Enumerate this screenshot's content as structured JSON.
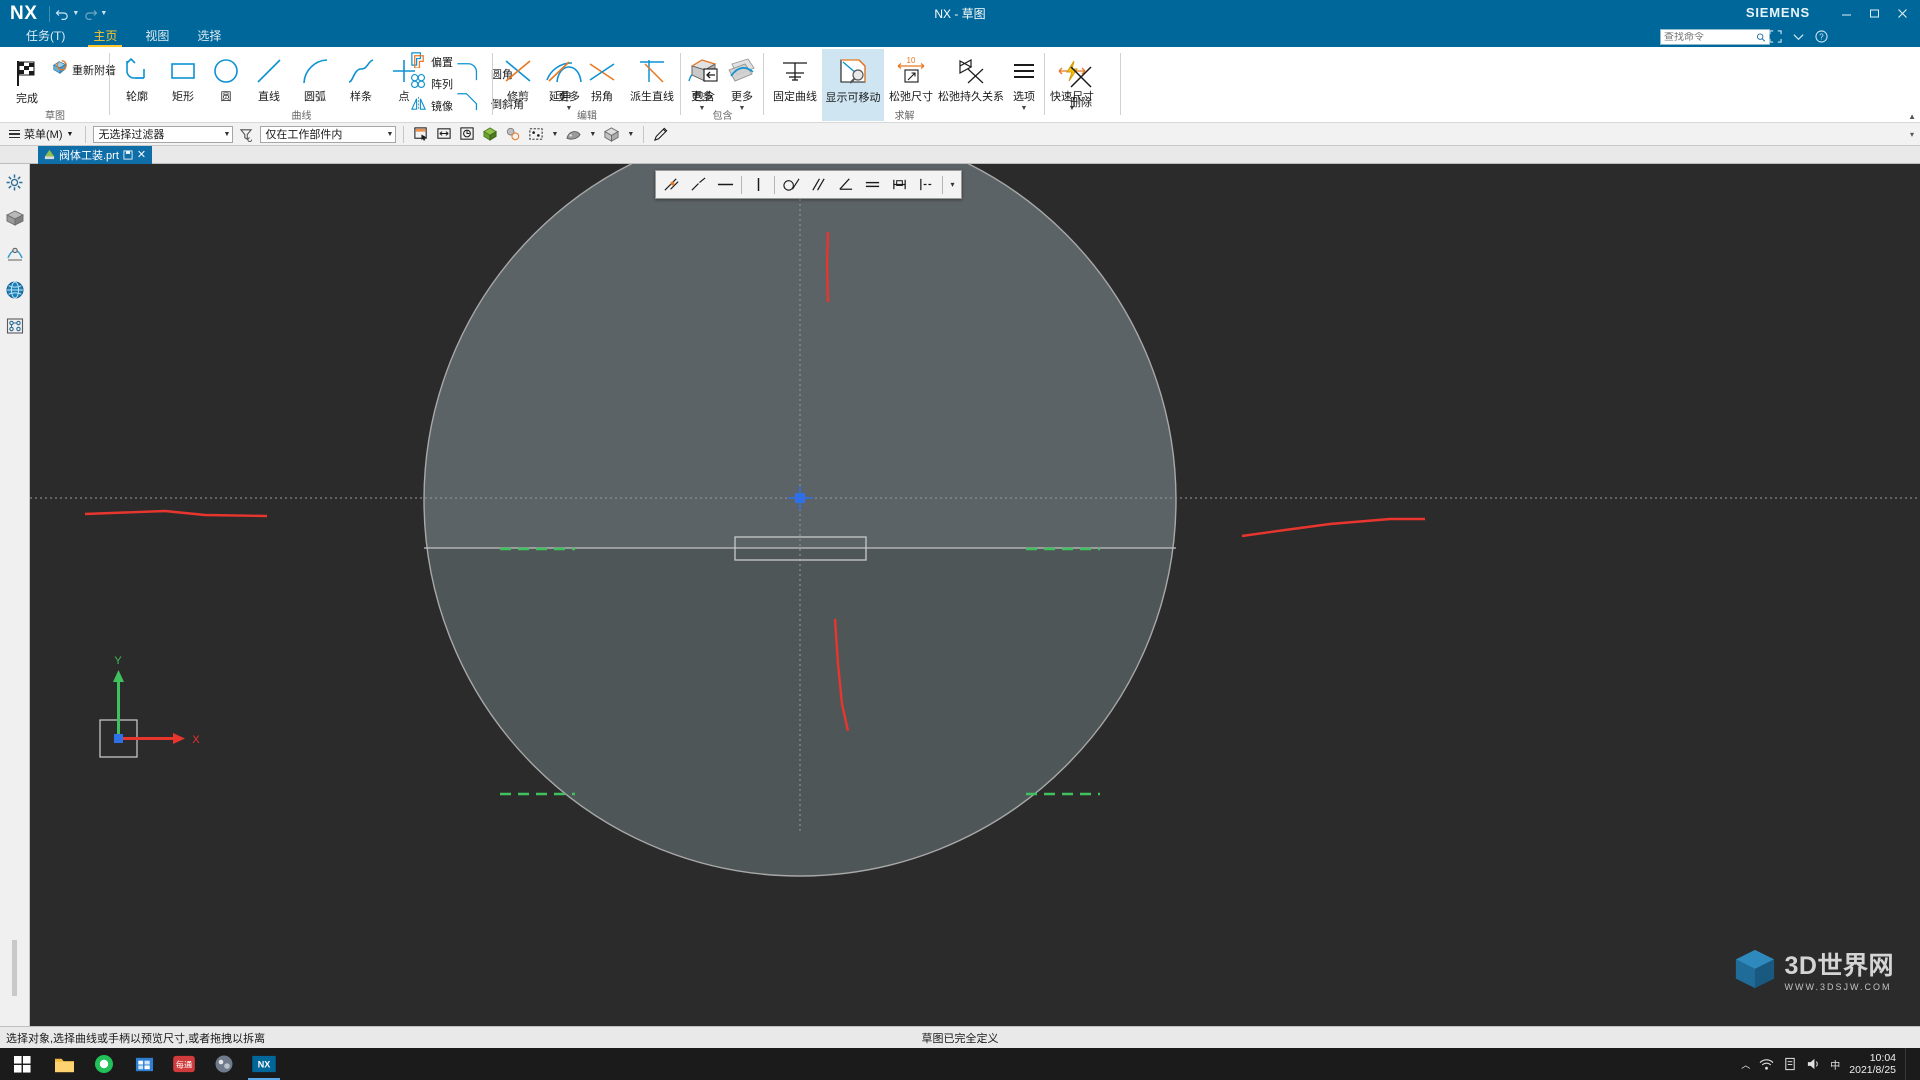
{
  "window": {
    "title": "NX - 草图",
    "brand": "SIEMENS",
    "logo": "NX",
    "quick_access": [
      "undo-icon",
      "redo-icon"
    ],
    "controls": [
      "minimize",
      "maximize",
      "close"
    ]
  },
  "tabs": [
    {
      "label": "任务(T)",
      "active": false
    },
    {
      "label": "主页",
      "active": true
    },
    {
      "label": "视图",
      "active": false
    },
    {
      "label": "选择",
      "active": false
    }
  ],
  "search": {
    "placeholder": "查找命令",
    "value": ""
  },
  "ribbon": {
    "groups": [
      {
        "name": "草图",
        "label": "草图",
        "buttons": [
          {
            "label": "完成",
            "icon": "finish-flag-icon",
            "type": "big"
          },
          {
            "label": "重新附着",
            "icon": "reattach-icon",
            "type": "small"
          }
        ]
      },
      {
        "name": "曲线",
        "label": "曲线",
        "buttons": [
          {
            "label": "轮廓",
            "icon": "profile-icon",
            "type": "big"
          },
          {
            "label": "矩形",
            "icon": "rectangle-icon",
            "type": "big"
          },
          {
            "label": "圆",
            "icon": "circle-icon",
            "type": "big"
          },
          {
            "label": "直线",
            "icon": "line-icon",
            "type": "big"
          },
          {
            "label": "圆弧",
            "icon": "arc-icon",
            "type": "big"
          },
          {
            "label": "样条",
            "icon": "spline-icon",
            "type": "big"
          },
          {
            "label": "点",
            "icon": "point-icon",
            "type": "big"
          },
          {
            "label": "圆角",
            "icon": "fillet-icon",
            "type": "small"
          },
          {
            "label": "倒斜角",
            "icon": "chamfer-icon",
            "type": "small"
          },
          {
            "label": "偏置",
            "icon": "offset-icon",
            "type": "small"
          },
          {
            "label": "阵列",
            "icon": "pattern-icon",
            "type": "small"
          },
          {
            "label": "镜像",
            "icon": "mirror-icon",
            "type": "small"
          },
          {
            "label": "更多",
            "icon": "more-curve-icon",
            "type": "big",
            "dropdown": true
          }
        ]
      },
      {
        "name": "编辑",
        "label": "编辑",
        "buttons": [
          {
            "label": "修剪",
            "icon": "trim-icon",
            "type": "big"
          },
          {
            "label": "延伸",
            "icon": "extend-icon",
            "type": "big"
          },
          {
            "label": "拐角",
            "icon": "corner-icon",
            "type": "big"
          },
          {
            "label": "派生直线",
            "icon": "derived-line-icon",
            "type": "big"
          },
          {
            "label": "更多",
            "icon": "more-edit-icon",
            "type": "big",
            "dropdown": true
          }
        ]
      },
      {
        "name": "包含",
        "label": "包含",
        "buttons": [
          {
            "label": "包含",
            "icon": "include-icon",
            "type": "big"
          },
          {
            "label": "更多",
            "icon": "more-include-icon",
            "type": "big",
            "dropdown": true
          }
        ]
      },
      {
        "name": "求解",
        "label": "求解",
        "buttons": [
          {
            "label": "固定曲线",
            "icon": "fix-curve-icon",
            "type": "big"
          },
          {
            "label": "显示可移动",
            "icon": "show-movable-icon",
            "type": "big",
            "selected": true
          },
          {
            "label": "松弛尺寸",
            "icon": "relax-dimension-icon",
            "type": "big"
          },
          {
            "label": "松弛持久关系",
            "icon": "relax-persistent-icon",
            "type": "big"
          },
          {
            "label": "选项",
            "icon": "options-icon",
            "type": "big",
            "dropdown": true
          },
          {
            "label": "快速尺寸",
            "icon": "quick-dimension-icon",
            "type": "big",
            "dropdown": true
          }
        ]
      },
      {
        "name": "删除",
        "label": "",
        "buttons": [
          {
            "label": "删除",
            "icon": "delete-x-icon",
            "type": "big"
          }
        ]
      }
    ]
  },
  "selection_bar": {
    "menu_label": "菜单(M)",
    "filter": {
      "value": "无选择过滤器",
      "placeholder": "无选择过滤器"
    },
    "scope": {
      "value": "仅在工作部件内",
      "placeholder": "仅在工作部件内"
    },
    "icons": [
      "select-face-icon",
      "select-edge-icon",
      "select-feature-icon",
      "shaded-icon",
      "wireframe-icon",
      "selection-window-icon",
      "render-style-icon"
    ]
  },
  "document_tab": {
    "name": "阀体工装.prt",
    "modified_icon": "save-state-icon",
    "close_icon": "close-icon"
  },
  "resource_bar": {
    "items": [
      "assembly-navigator-icon",
      "part-navigator-icon",
      "constraint-navigator-icon",
      "web-browser-icon",
      "history-icon"
    ]
  },
  "canvas_toolbar": {
    "buttons": [
      "coincident-constraint-icon",
      "collinear-constraint-icon",
      "horizontal-constraint-icon",
      "vertical-constraint-icon",
      "tangent-constraint-icon",
      "parallel-constraint-icon",
      "perpendicular-constraint-icon",
      "equal-length-constraint-icon",
      "midpoint-constraint-icon",
      "dimension-icon"
    ],
    "overflow": "more-constraints-caret"
  },
  "triad": {
    "x_label": "X",
    "y_label": "Y"
  },
  "status": {
    "left": "选择对象,选择曲线或手柄以预览尺寸,或者拖拽以拆离",
    "center": "草图已完全定义"
  },
  "taskbar": {
    "start": "windows-start-icon",
    "apps": [
      {
        "name": "file-explorer-icon",
        "active": false
      },
      {
        "name": "browser-icon",
        "active": false
      },
      {
        "name": "store-icon",
        "active": false
      },
      {
        "name": "media-app-icon",
        "active": false,
        "label": "每通"
      },
      {
        "name": "misc-app-icon",
        "active": false
      },
      {
        "name": "nx-app-icon",
        "active": true,
        "label": "NX"
      }
    ],
    "tray_icons": [
      "chevron-up-icon",
      "network-icon",
      "sound-icon",
      "ime-icon"
    ],
    "clock_time": "10:04",
    "clock_date": "2021/8/25"
  },
  "watermark": {
    "title": "3D世界网",
    "subtitle": "WWW.3DSJW.COM"
  },
  "colors": {
    "title_bar": "#00679a",
    "ribbon_bg": "#ffffff",
    "accent_blue": "#0d92d2",
    "accent_orange": "#e87722",
    "tab_active": "#ffc62e",
    "canvas_bg": "#2b2b2b",
    "sketch_face": "#5a6163",
    "sketch_face_lower": "#4d5456",
    "red_curve": "#e8352e",
    "green_dash": "#3fc15e",
    "selected_btn": "#cfe6f2"
  }
}
